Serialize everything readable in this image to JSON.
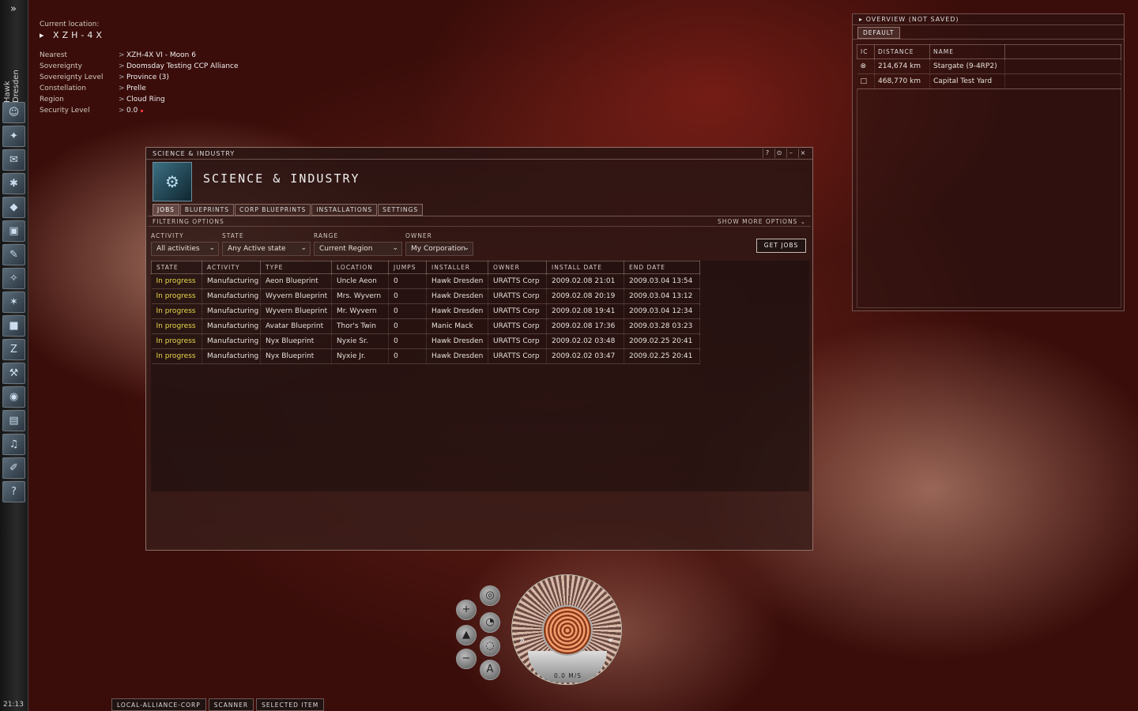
{
  "neocom": {
    "expand_glyph": "»",
    "character_name": "Hawk Dresden",
    "clock": "21:13",
    "buttons": [
      {
        "name": "character-sheet-icon",
        "glyph": "☺"
      },
      {
        "name": "people-places-icon",
        "glyph": "✦"
      },
      {
        "name": "mail-icon",
        "glyph": "✉"
      },
      {
        "name": "skills-icon",
        "glyph": "✱"
      },
      {
        "name": "assets-icon",
        "glyph": "◆"
      },
      {
        "name": "market-icon",
        "glyph": "▣"
      },
      {
        "name": "journal-icon",
        "glyph": "✎"
      },
      {
        "name": "map-icon",
        "glyph": "✧"
      },
      {
        "name": "starmap-icon",
        "glyph": "✶"
      },
      {
        "name": "ship-hangar-icon",
        "glyph": "■"
      },
      {
        "name": "science-industry-icon",
        "glyph": "Z"
      },
      {
        "name": "fitting-icon",
        "glyph": "⚒"
      },
      {
        "name": "world-icon",
        "glyph": "◉"
      },
      {
        "name": "notepad-icon",
        "glyph": "▤"
      },
      {
        "name": "audio-icon",
        "glyph": "♫"
      },
      {
        "name": "browser-icon",
        "glyph": "✐"
      },
      {
        "name": "help-icon",
        "glyph": "?"
      }
    ]
  },
  "location": {
    "current_label": "Current location:",
    "current_value": "XZH-4X",
    "rows": [
      {
        "key": "Nearest",
        "value": "XZH-4X VI - Moon 6"
      },
      {
        "key": "Sovereignty",
        "value": "Doomsday Testing CCP Alliance"
      },
      {
        "key": "Sovereignty Level",
        "value": "Province (3)"
      },
      {
        "key": "Constellation",
        "value": "Prelle"
      },
      {
        "key": "Region",
        "value": "Cloud Ring"
      },
      {
        "key": "Security Level",
        "value": "0.0"
      }
    ]
  },
  "overview": {
    "title": "OVERVIEW (NOT SAVED)",
    "tab": "DEFAULT",
    "columns": [
      "IC",
      "DISTANCE",
      "NAME"
    ],
    "rows": [
      {
        "icon": "stargate-icon",
        "glyph": "⊗",
        "distance": "214,674 km",
        "name": "Stargate (9-4RP2)"
      },
      {
        "icon": "station-icon",
        "glyph": "□",
        "distance": "468,770 km",
        "name": "Capital Test Yard"
      }
    ]
  },
  "si": {
    "window_title": "SCIENCE & INDUSTRY",
    "header_title": "SCIENCE & INDUSTRY",
    "window_buttons": [
      "?",
      "⊙",
      "–",
      "×"
    ],
    "tabs": [
      "JOBS",
      "BLUEPRINTS",
      "CORP BLUEPRINTS",
      "INSTALLATIONS",
      "SETTINGS"
    ],
    "filtering_options": "FILTERING OPTIONS",
    "show_more": "SHOW MORE OPTIONS",
    "filters": {
      "activity": {
        "label": "ACTIVITY",
        "value": "All activities"
      },
      "state": {
        "label": "STATE",
        "value": "Any Active state"
      },
      "range": {
        "label": "RANGE",
        "value": "Current Region"
      },
      "owner": {
        "label": "OWNER",
        "value": "My Corporation"
      }
    },
    "get_jobs": "GET JOBS",
    "columns": [
      "STATE",
      "ACTIVITY",
      "TYPE",
      "LOCATION",
      "JUMPS",
      "INSTALLER",
      "OWNER",
      "INSTALL DATE",
      "END DATE"
    ],
    "jobs": [
      [
        "In progress",
        "Manufacturing",
        "Aeon Blueprint",
        "Uncle Aeon",
        "0",
        "Hawk Dresden",
        "URATTS Corp",
        "2009.02.08 21:01",
        "2009.03.04 13:54"
      ],
      [
        "In progress",
        "Manufacturing",
        "Wyvern Blueprint",
        "Mrs. Wyvern",
        "0",
        "Hawk Dresden",
        "URATTS Corp",
        "2009.02.08 20:19",
        "2009.03.04 13:12"
      ],
      [
        "In progress",
        "Manufacturing",
        "Wyvern Blueprint",
        "Mr. Wyvern",
        "0",
        "Hawk Dresden",
        "URATTS Corp",
        "2009.02.08 19:41",
        "2009.03.04 12:34"
      ],
      [
        "In progress",
        "Manufacturing",
        "Avatar Blueprint",
        "Thor's Twin",
        "0",
        "Manic Mack",
        "URATTS Corp",
        "2009.02.08 17:36",
        "2009.03.28 03:23"
      ],
      [
        "In progress",
        "Manufacturing",
        "Nyx Blueprint",
        "Nyxie Sr.",
        "0",
        "Hawk Dresden",
        "URATTS Corp",
        "2009.02.02 03:48",
        "2009.02.25 20:41"
      ],
      [
        "In progress",
        "Manufacturing",
        "Nyx Blueprint",
        "Nyxie Jr.",
        "0",
        "Hawk Dresden",
        "URATTS Corp",
        "2009.02.02 03:47",
        "2009.02.25 20:41"
      ]
    ]
  },
  "hud": {
    "speed": "0.0 M/S",
    "left_arrow": "»",
    "right_arrow": "«",
    "autopilot_label": "A"
  },
  "bottom_tabs": [
    "LOCAL-ALLIANCE-CORP",
    "SCANNER",
    "SELECTED ITEM"
  ],
  "colors": {
    "state_in_progress": "#e8d84a",
    "security_dot": "#ee3333"
  }
}
